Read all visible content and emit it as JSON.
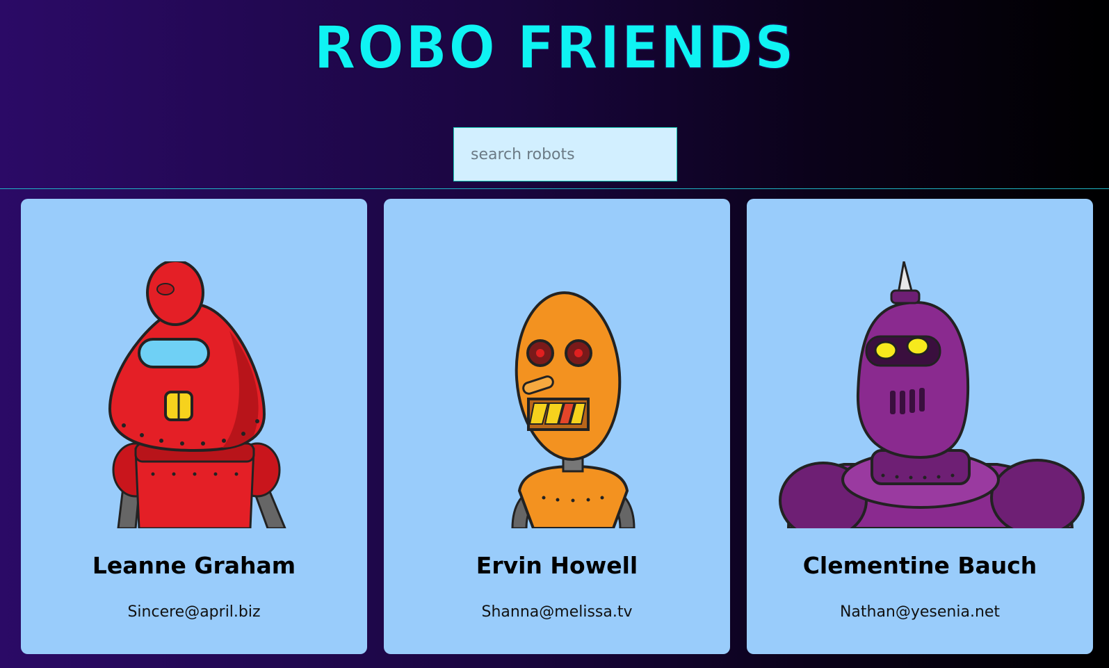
{
  "app": {
    "title": "ROBO FRIENDS"
  },
  "search": {
    "placeholder": "search robots",
    "value": ""
  },
  "robots": [
    {
      "name": "Leanne Graham",
      "email": "Sincere@april.biz",
      "color": "#e41f26"
    },
    {
      "name": "Ervin Howell",
      "email": "Shanna@melissa.tv",
      "color": "#f39220"
    },
    {
      "name": "Clementine Bauch",
      "email": "Nathan@yesenia.net",
      "color": "#8a2a8f"
    }
  ],
  "colors": {
    "title": "#0ff3f3",
    "card_bg": "#99ccfb",
    "search_bg": "#d2efff",
    "header_rule": "#1fb5c4"
  }
}
